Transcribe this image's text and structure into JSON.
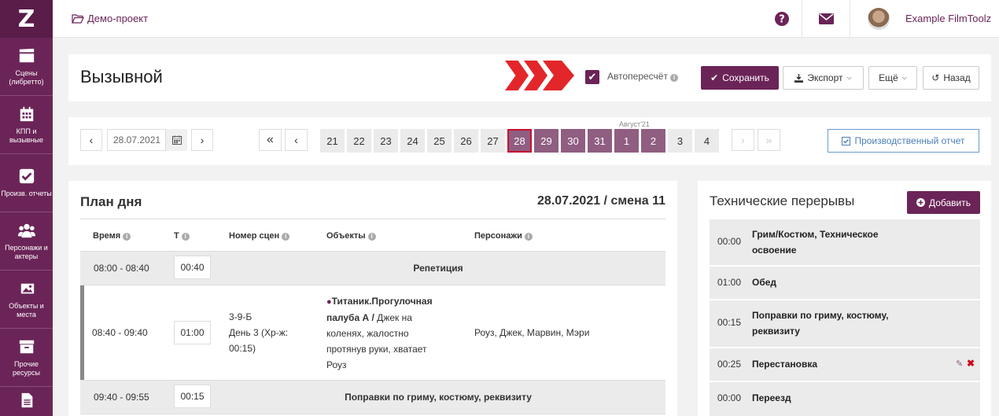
{
  "sidebar": {
    "logo": "Z",
    "items": [
      {
        "label": "Сцены (либретто)",
        "icon": "clapperboard-icon"
      },
      {
        "label": "КПП и вызывные",
        "icon": "calendar-icon"
      },
      {
        "label": "Произв. отчеты",
        "icon": "checkbox-icon"
      },
      {
        "label": "Персонажи и актеры",
        "icon": "users-icon"
      },
      {
        "label": "Объекты и места",
        "icon": "image-icon"
      },
      {
        "label": "Прочие ресурсы",
        "icon": "archive-icon"
      },
      {
        "label": "",
        "icon": "document-icon"
      }
    ]
  },
  "topbar": {
    "project": "Демо-проект",
    "user": "Example FilmToolz"
  },
  "header": {
    "title": "Вызывной",
    "autorecalc_label": "Автопересчёт",
    "autorecalc_checked": true,
    "save": "Сохранить",
    "export": "Экспорт",
    "more": "Ещё",
    "back": "Назад"
  },
  "date_nav": {
    "date": "28.07.2021",
    "month_label": "Август'21",
    "days": [
      {
        "label": "21",
        "state": "normal"
      },
      {
        "label": "22",
        "state": "normal"
      },
      {
        "label": "23",
        "state": "normal"
      },
      {
        "label": "24",
        "state": "normal"
      },
      {
        "label": "25",
        "state": "normal"
      },
      {
        "label": "26",
        "state": "normal"
      },
      {
        "label": "27",
        "state": "normal"
      },
      {
        "label": "28",
        "state": "current"
      },
      {
        "label": "29",
        "state": "planned"
      },
      {
        "label": "30",
        "state": "planned"
      },
      {
        "label": "31",
        "state": "planned"
      },
      {
        "label": "1",
        "state": "planned"
      },
      {
        "label": "2",
        "state": "planned"
      },
      {
        "label": "3",
        "state": "normal"
      },
      {
        "label": "4",
        "state": "normal"
      }
    ],
    "report_button": "Производственный отчет"
  },
  "plan": {
    "title": "План дня",
    "date_shift": "28.07.2021 / смена 11",
    "columns": [
      "Время",
      "Т",
      "Номер сцен",
      "Объекты",
      "Персонажи"
    ],
    "rows": [
      {
        "time": "08:00 - 08:40",
        "duration": "00:40",
        "title": "Репетиция"
      },
      {
        "time": "08:40 - 09:40",
        "duration": "01:00",
        "scene": "3-9-Б",
        "scene_day": "День 3 (Хр-ж: 00:15)",
        "location": "Титаник.Прогулочная палуба А /",
        "description": "Джек на коленях, жалостно протянув руки, хватает Роуз",
        "characters": "Роуз, Джек, Марвин, Мэри"
      },
      {
        "time": "09:40 - 09:55",
        "duration": "00:15",
        "title": "Поправки по гриму, костюму, реквизиту"
      }
    ]
  },
  "breaks": {
    "title": "Технические перерывы",
    "add": "Добавить",
    "items": [
      {
        "time": "00:00",
        "label": "Грим/Костюм, Техническое освоение"
      },
      {
        "time": "01:00",
        "label": "Обед"
      },
      {
        "time": "00:15",
        "label": "Поправки по гриму, костюму, реквизиту"
      },
      {
        "time": "00:25",
        "label": "Перестановка"
      },
      {
        "time": "00:00",
        "label": "Переезд"
      }
    ]
  }
}
